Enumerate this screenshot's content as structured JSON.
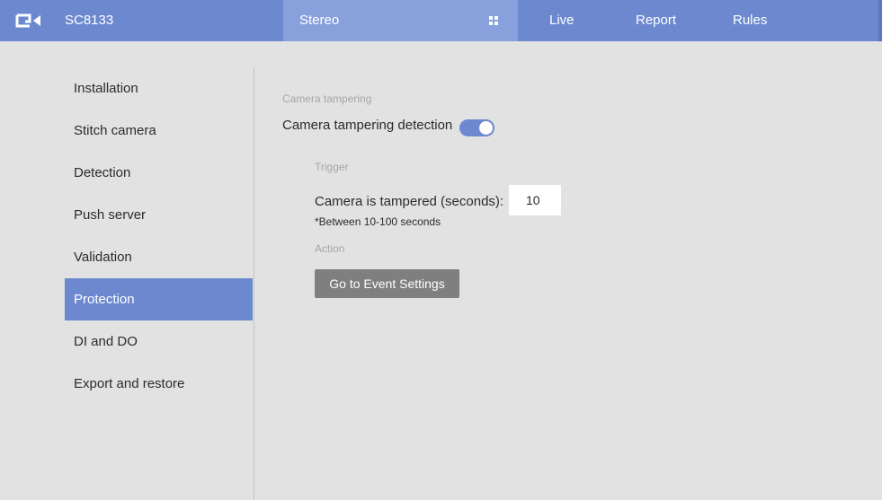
{
  "header": {
    "logo_icon": "vivotek-logo-icon",
    "model": "SC8133",
    "stereo_tab": "Stereo",
    "grid_icon": "grid-icon",
    "nav": [
      "Live",
      "Report",
      "Rules"
    ]
  },
  "sidebar": {
    "items": [
      {
        "label": "Installation",
        "active": false
      },
      {
        "label": "Stitch camera",
        "active": false
      },
      {
        "label": "Detection",
        "active": false
      },
      {
        "label": "Push server",
        "active": false
      },
      {
        "label": "Validation",
        "active": false
      },
      {
        "label": "Protection",
        "active": true
      },
      {
        "label": "DI and DO",
        "active": false
      },
      {
        "label": "Export and restore",
        "active": false
      }
    ]
  },
  "content": {
    "section_title": "Camera tampering",
    "detection_label": "Camera tampering detection",
    "detection_enabled": true,
    "trigger_title": "Trigger",
    "tampered_label": "Camera is tampered (seconds):",
    "tampered_value": "10",
    "hint": "*Between 10-100 seconds",
    "action_title": "Action",
    "event_button": "Go to Event Settings"
  },
  "colors": {
    "accent": "#6c88cf",
    "tab_highlight": "#88a0dc",
    "background": "#e2e2e2",
    "button": "#7f7f7f"
  }
}
